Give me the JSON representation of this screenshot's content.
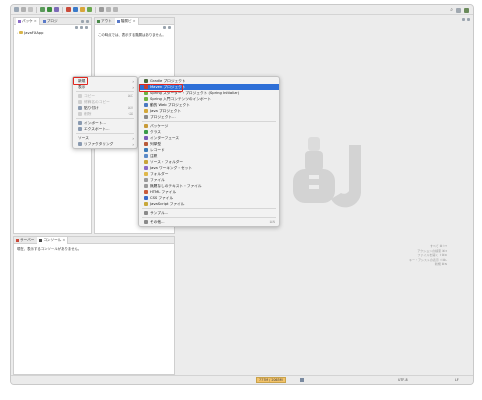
{
  "toolbar": {
    "icon_names": [
      "new-icon",
      "save-icon",
      "run-icon",
      "debug-icon",
      "search-icon",
      "perspective-icon"
    ]
  },
  "left_pane": {
    "tabs": [
      {
        "label": "パッケ",
        "icon": "package-explorer-icon"
      },
      {
        "label": "プロジ",
        "icon": "project-explorer-icon"
      }
    ],
    "project_name": "JavaFXApp"
  },
  "outline_pane": {
    "tabs": [
      {
        "label": "アウト",
        "icon": "outline-icon"
      },
      {
        "label": "階層ビ",
        "icon": "hierarchy-icon"
      }
    ],
    "message": "この時点では、表示する階層はありません。"
  },
  "console_pane": {
    "tabs": [
      {
        "label": "サーバー",
        "icon": "server-icon"
      },
      {
        "label": "コンソール",
        "icon": "console-icon"
      }
    ],
    "message": "現在、表示するコンソールがありません。"
  },
  "context_menu": {
    "items": [
      {
        "label": "新規",
        "submenu": true,
        "highlighted": true
      },
      {
        "label": "表示",
        "submenu": true
      },
      {
        "sep": true
      },
      {
        "label": "コピー",
        "shortcut": "⌘C",
        "disabled": true
      },
      {
        "label": "修飾名のコピー",
        "disabled": true
      },
      {
        "label": "貼り付け",
        "shortcut": "⌘V"
      },
      {
        "label": "削除",
        "shortcut": "⌫",
        "disabled": true
      },
      {
        "sep": true
      },
      {
        "label": "インポート..."
      },
      {
        "label": "エクスポート..."
      },
      {
        "sep": true
      },
      {
        "label": "ソース",
        "submenu": true
      },
      {
        "label": "リファクタリング",
        "submenu": true
      }
    ]
  },
  "submenu": {
    "items": [
      {
        "label": "Gradle プロジェクト",
        "icon_color": "#4a6a3a"
      },
      {
        "label": "Maven プロジェクト",
        "icon_color": "#c8402e",
        "highlighted": true
      },
      {
        "label": "Spring スターター・プロジェクト (Spring Initializr)",
        "icon_color": "#6db33f"
      },
      {
        "label": "Spring 入門コンテンツのインポート",
        "icon_color": "#6db33f"
      },
      {
        "label": "動的 Web プロジェクト",
        "icon_color": "#4a78c2"
      },
      {
        "label": "Java プロジェクト",
        "icon_color": "#d4a83a"
      },
      {
        "label": "プロジェクト...",
        "icon_color": "#8a8a8a"
      },
      {
        "sep": true
      },
      {
        "label": "パッケージ",
        "icon_color": "#c89b3a"
      },
      {
        "label": "クラス",
        "icon_color": "#3a9a4a"
      },
      {
        "label": "インターフェース",
        "icon_color": "#7a5ab8"
      },
      {
        "label": "列挙型",
        "icon_color": "#b85a3a"
      },
      {
        "label": "レコード",
        "icon_color": "#3a7ab8"
      },
      {
        "label": "注釈",
        "icon_color": "#5a8ac8"
      },
      {
        "label": "ソース・フォルダー",
        "icon_color": "#c8a43a"
      },
      {
        "label": "Java ワーキング・セット",
        "icon_color": "#8a6ac8"
      },
      {
        "label": "フォルダー",
        "icon_color": "#e0b84a"
      },
      {
        "label": "ファイル",
        "icon_color": "#9a9a9a"
      },
      {
        "label": "無題なしのテキスト・ファイル",
        "icon_color": "#9a9a9a"
      },
      {
        "label": "HTML ファイル",
        "icon_color": "#c85a3a"
      },
      {
        "label": "CSS ファイル",
        "icon_color": "#3a6ac8"
      },
      {
        "label": "JavaScript ファイル",
        "icon_color": "#c8a83a"
      },
      {
        "sep": true
      },
      {
        "label": "サンプル...",
        "icon_color": "#8a8a8a"
      },
      {
        "sep": true
      },
      {
        "label": "その他...",
        "shortcut": "⌘N",
        "icon_color": "#8a8a8a"
      }
    ]
  },
  "watermark": {
    "lines": [
      [
        "すべて",
        "⌘⇧T"
      ],
      [
        "アクションの検索",
        "⌘3"
      ],
      [
        "ファイルを開く",
        "⇧⌘R"
      ],
      [
        "キー・アシストの表示",
        "⇧⌘L"
      ],
      [
        "新規",
        "⌘N"
      ]
    ]
  },
  "statusbar": {
    "memory": "777M / 2065M",
    "encoding": "UTF-8",
    "line_ending": "LF"
  },
  "colors": {
    "highlight": "#2e6fd7",
    "annotation_red": "#e0261f"
  }
}
